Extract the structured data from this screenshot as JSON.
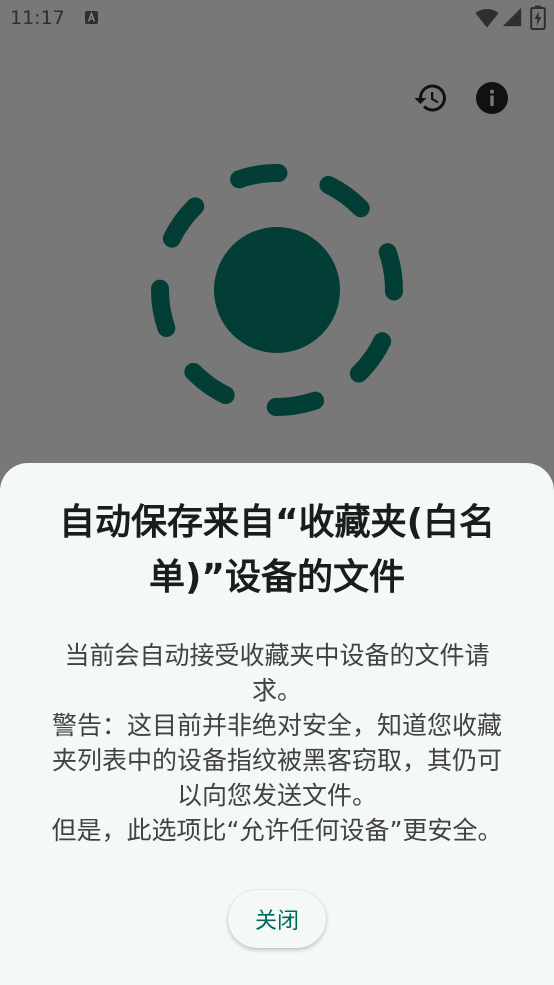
{
  "status_bar": {
    "time": "11:17",
    "icons": [
      "text-a-notification-icon",
      "wifi-icon",
      "cellular-signal-icon",
      "battery-charging-icon"
    ]
  },
  "app_bar": {
    "actions": [
      "history-icon",
      "info-icon"
    ]
  },
  "hero": {
    "icon": "app-logo-icon"
  },
  "dialog": {
    "title_lines": [
      "自动保存来自“收藏夹(白名",
      "单)”设备的文件"
    ],
    "body_lines": [
      "当前会自动接受收藏夹中设备的文件请",
      "求。",
      "警告：这目前并非绝对安全，知道您收藏",
      "夹列表中的设备指纹被黑客窃取，其仍可",
      "以向您发送文件。",
      "但是，此选项比“允许任何设备”更安全。"
    ],
    "close_label": "关闭"
  },
  "colors": {
    "scrim": "#787878",
    "sheet": "#f4f9f7",
    "accent": "#00695c",
    "logo": "#023d36"
  }
}
